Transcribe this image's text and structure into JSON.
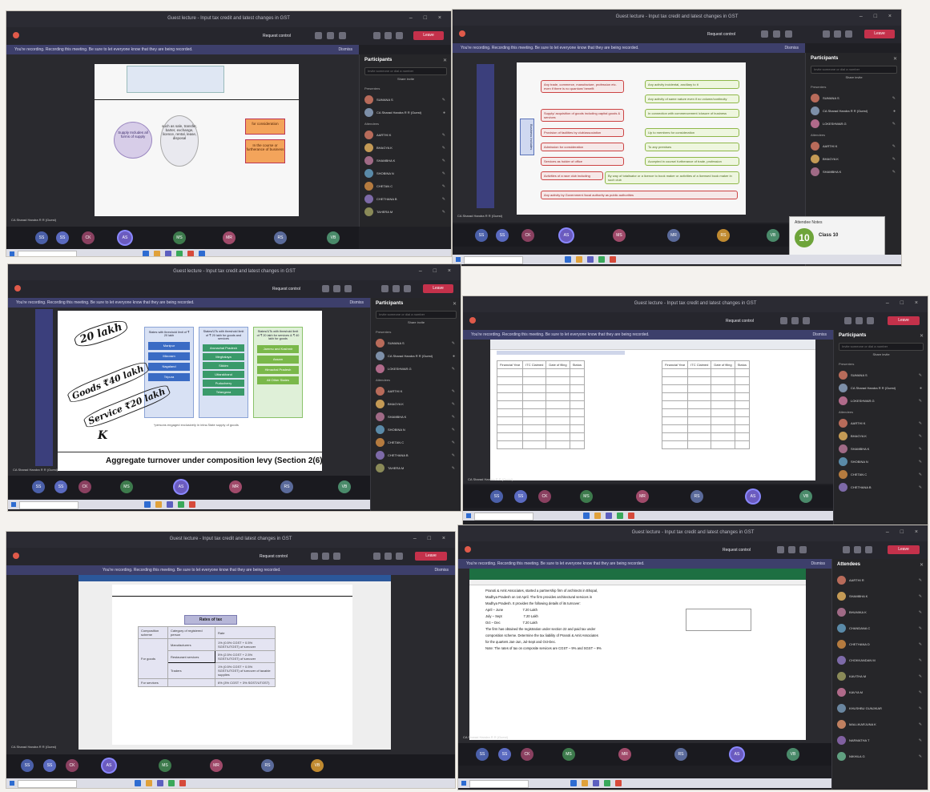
{
  "meeting": {
    "title": "Guest lecture - Input tax credit and latest changes in GST",
    "window_controls": "– □ ×",
    "recording_banner": "You're recording. Recording this meeting. Be sure to let everyone know that they are being recorded.",
    "dismiss": "Dismiss",
    "request_control": "Request control",
    "leave": "Leave",
    "participants_label": "Participants",
    "attendees_label": "Attendees",
    "search_placeholder": "Invite someone or dial a number",
    "share_invite": "Share invite",
    "presenters_group": "Presenters",
    "attendees_group": "Attendees",
    "mute_all": "Mute all"
  },
  "shots": [
    {
      "id": "1",
      "sharer": "CA Sharad Handra R R (Guest)",
      "slide": {
        "supply": "Supply Includes all forms of supply",
        "list": "such as sale, transfer, barter, exchange, licence, rental, lease, disposal",
        "for": "for consideration",
        "course": "In the course or furtherance of business"
      },
      "video": [
        "SS",
        "SS",
        "CK",
        "AS",
        "MS",
        "MR",
        "RS",
        "VB"
      ]
    },
    {
      "id": "2",
      "sharer": "CA Sharad Handra R R (Guest)",
      "slide": {
        "center": "Business Includes",
        "rows": [
          [
            "Any trade, commerce, manufacture, profession etc. even if there is no quantum/ benefit",
            "Any activity incidental, ancillary to it"
          ],
          [
            "",
            "Any activity of same nature even if no volume/continuity"
          ],
          [
            "Supply/ acquisition of goods including capital goods & services",
            "In connection with commencement /closure of business"
          ],
          [
            "Provision of facilities by club/association",
            "Up to members for consideration"
          ],
          [
            "Admission for consideration",
            "To any premises"
          ],
          [
            "Services as holder of office",
            "Accepted in course/ furtherance of trade, profession"
          ],
          [
            "Activities of a race club including",
            "By way of totalisator or a licence to book maker or activities of a licensed book maker in such club"
          ],
          [
            "Any activity by Government /local authority as public authorities",
            ""
          ]
        ]
      },
      "notification": {
        "title": "Attendee Notes",
        "text": "Class 10",
        "badge": "10"
      }
    },
    {
      "id": "3",
      "sharer": "CA Sharad Handra R R (Guest)",
      "slide": {
        "hand1": "20 lakh",
        "hand2": "Goods ₹40 lakh",
        "hand3": "Service ₹20 lakh",
        "hand4": "K",
        "col1": "States with threshold limit of ₹ 20 lakh",
        "col2": "States/UTs with threshold limit of ₹ 20 lakh for goods and services",
        "col3": "States/UTs with threshold limit of ₹ 20 lakh for services & ₹ 40 lakh for goods",
        "c1": [
          "Manipur",
          "Mizoram",
          "Nagaland",
          "Tripura"
        ],
        "c2": [
          "Arunachal Pradesh",
          "Meghalaya",
          "Sikkim",
          "Uttarakhand",
          "Puducherry",
          "Telangana"
        ],
        "c3": [
          "Jammu and Kashmir",
          "Assam",
          "Himachal Pradesh",
          "All Other States"
        ],
        "note": "*persons engaged exclusively in intra-State supply of goods",
        "heading": "Aggregate turnover under composition levy (Section 2(6) re"
      }
    },
    {
      "id": "4",
      "sharer": "CA Sharad Handra R R (Guest)",
      "table_headers": [
        "Financial Year",
        "ITC Claimed",
        "Date of filing",
        "Status"
      ],
      "rows": 11
    },
    {
      "id": "5",
      "sharer": "CA Sharad Handra R R (Guest)",
      "slide": {
        "title": "Rates of tax",
        "h1": "Composition scheme",
        "h2": "Category of registered person",
        "h3": "Rate",
        "r1a": "For goods",
        "r1b": "Manufacturers",
        "r1c": "1% (0.5% CGST + 0.5% SGST/UTGST) of turnover",
        "r2b": "Restaurant services",
        "r2c": "5% (2.5% CGST + 2.5% SGST/UTGST) of turnover",
        "r3b": "Traders",
        "r3c": "1% (0.5% CGST + 0.5% SGST/UTGST) of turnover of taxable supplies",
        "r4a": "For services",
        "r4c": "6% (3% CGST + 3% SGST/UTGST)"
      }
    },
    {
      "id": "6",
      "sharer": "CA Sharad Handra R R (Guest)",
      "sheet_text": [
        "Pranoti & Amit Associates, started a partnership firm of architects in Bhopal,",
        "Madhya Pradesh on 1st April. The firm provides architectural services in",
        "Madhya Pradesh. It provides the following details of its turnover:",
        "April – June                     7.20 Lakh",
        "July – Sept                       7.20 Lakh",
        "Oct – Dec                        7.20 Lakh",
        "The firm has obtained the registration under section 22 and paid tax under",
        "composition scheme. Determine the tax liability of Pranoti & Amit Associates",
        "for the quarters Jan-Jun, Jul-Sept and Oct-Dec.",
        "Note: The rates of tax on composite services are CGST – 9% and SGST – 9%"
      ]
    }
  ],
  "participants": [
    "SUMANA S",
    "CA Sharad Handra R R (Guest)",
    "LOKESHWAR.G",
    "AARTHI K",
    "BHAGYA K",
    "SHAMBHA K",
    "SHOBINA N",
    "CHETAN C",
    "CHETHANA B",
    "TAHERA M"
  ],
  "attendees": [
    "AARTHI R",
    "SHAMBHA K",
    "BHUMIKA K",
    "CHANDANA C",
    "CHETHANA D",
    "CHOKKANDAN M",
    "KAVITHA M",
    "KAVYA M",
    "KHUSHBU GUNJIKAR",
    "MALLIKARJUNA K",
    "NARMATHA T",
    "NIKHILA G"
  ],
  "colors": {
    "teams_purple": "#464775",
    "leave_red": "#c4314b",
    "panel_bg": "#262629"
  }
}
